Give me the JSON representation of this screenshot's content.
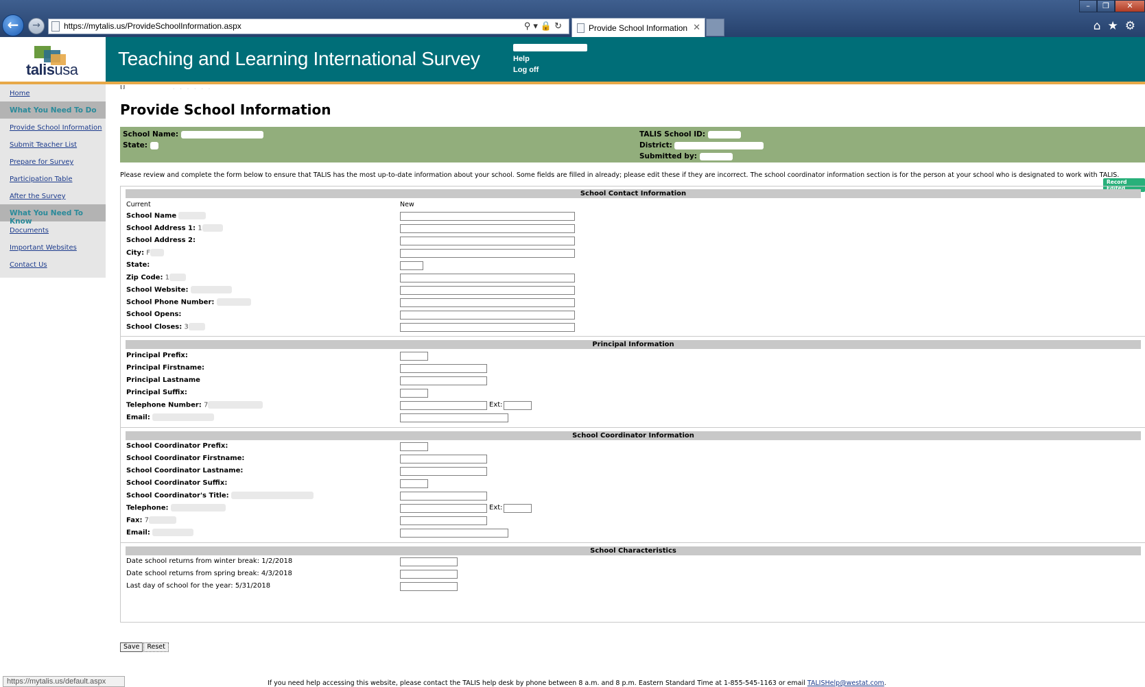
{
  "browser": {
    "url": "https://mytalis.us/ProvideSchoolInformation.aspx",
    "tab_title": "Provide School Information",
    "status_url": "https://mytalis.us/default.aspx"
  },
  "header": {
    "logo_main": "talis",
    "logo_sub": "usa",
    "site_title": "Teaching and Learning International Survey",
    "links": [
      "Help",
      "Log off"
    ]
  },
  "sidebar": {
    "items": [
      {
        "label": "Home",
        "type": "link"
      },
      {
        "label": "What You Need To Do",
        "type": "heading"
      },
      {
        "label": "Provide School Information",
        "type": "link"
      },
      {
        "label": "Submit Teacher List",
        "type": "link"
      },
      {
        "label": "Prepare for Survey",
        "type": "link"
      },
      {
        "label": "Participation Table",
        "type": "link"
      },
      {
        "label": "After the Survey",
        "type": "link"
      },
      {
        "label": "What You Need To Know",
        "type": "heading"
      },
      {
        "label": "Documents",
        "type": "link"
      },
      {
        "label": "Important Websites",
        "type": "link"
      },
      {
        "label": "Contact Us",
        "type": "link"
      }
    ]
  },
  "main": {
    "page_title": "Provide School Information",
    "band": {
      "school_name": "School Name:",
      "state": "State:",
      "school_id": "TALIS School ID:",
      "district": "District:",
      "submitted_by": "Submitted by:"
    },
    "intro": "Please review and complete the form below to ensure that TALIS has the most up-to-date information about your school. Some fields are filled in already; please edit these if they are incorrect. The school coordinator information section is for the person at your school who is designated to work with TALIS.",
    "record_edited": "Record Edited",
    "col_current": "Current",
    "col_new": "New",
    "ext_label": "Ext:",
    "sections": {
      "contact": "School Contact Information",
      "principal": "Principal Information",
      "coordinator": "School Coordinator Information",
      "characteristics": "School Characteristics"
    },
    "contact_fields": [
      "School Name",
      "School Address 1:",
      "School Address 2:",
      "City:",
      "State:",
      "Zip Code:",
      "School Website:",
      "School Phone Number:",
      "School Opens:",
      "School Closes:"
    ],
    "contact_values": [
      "",
      "1",
      "",
      "F",
      "",
      "1",
      "",
      "",
      "",
      "3"
    ],
    "principal_fields": [
      "Principal Prefix:",
      "Principal Firstname:",
      "Principal Lastname",
      "Principal Suffix:",
      "Telephone Number:",
      "Email:"
    ],
    "principal_values": [
      "",
      "",
      "",
      "",
      "7",
      ""
    ],
    "coordinator_fields": [
      "School Coordinator Prefix:",
      "School Coordinator Firstname:",
      "School Coordinator Lastname:",
      "School Coordinator Suffix:",
      "School Coordinator's Title:",
      "Telephone:",
      "Fax:",
      "Email:"
    ],
    "coordinator_values": [
      "",
      "",
      "",
      "",
      "",
      "",
      "7",
      ""
    ],
    "characteristics": [
      {
        "label": "Date school returns from winter break:",
        "value": "1/2/2018"
      },
      {
        "label": "Date school returns from spring break:",
        "value": "4/3/2018"
      },
      {
        "label": "Last day of school for the year:",
        "value": "5/31/2018"
      }
    ],
    "buttons": {
      "save": "Save",
      "reset": "Reset"
    }
  },
  "footer": {
    "text": "If you need help accessing this website, please contact the TALIS help desk by phone between 8 a.m. and 8 p.m. Eastern Standard Time at 1-855-545-1163 or email",
    "email": "TALISHelp@westat.com",
    "end": "."
  }
}
